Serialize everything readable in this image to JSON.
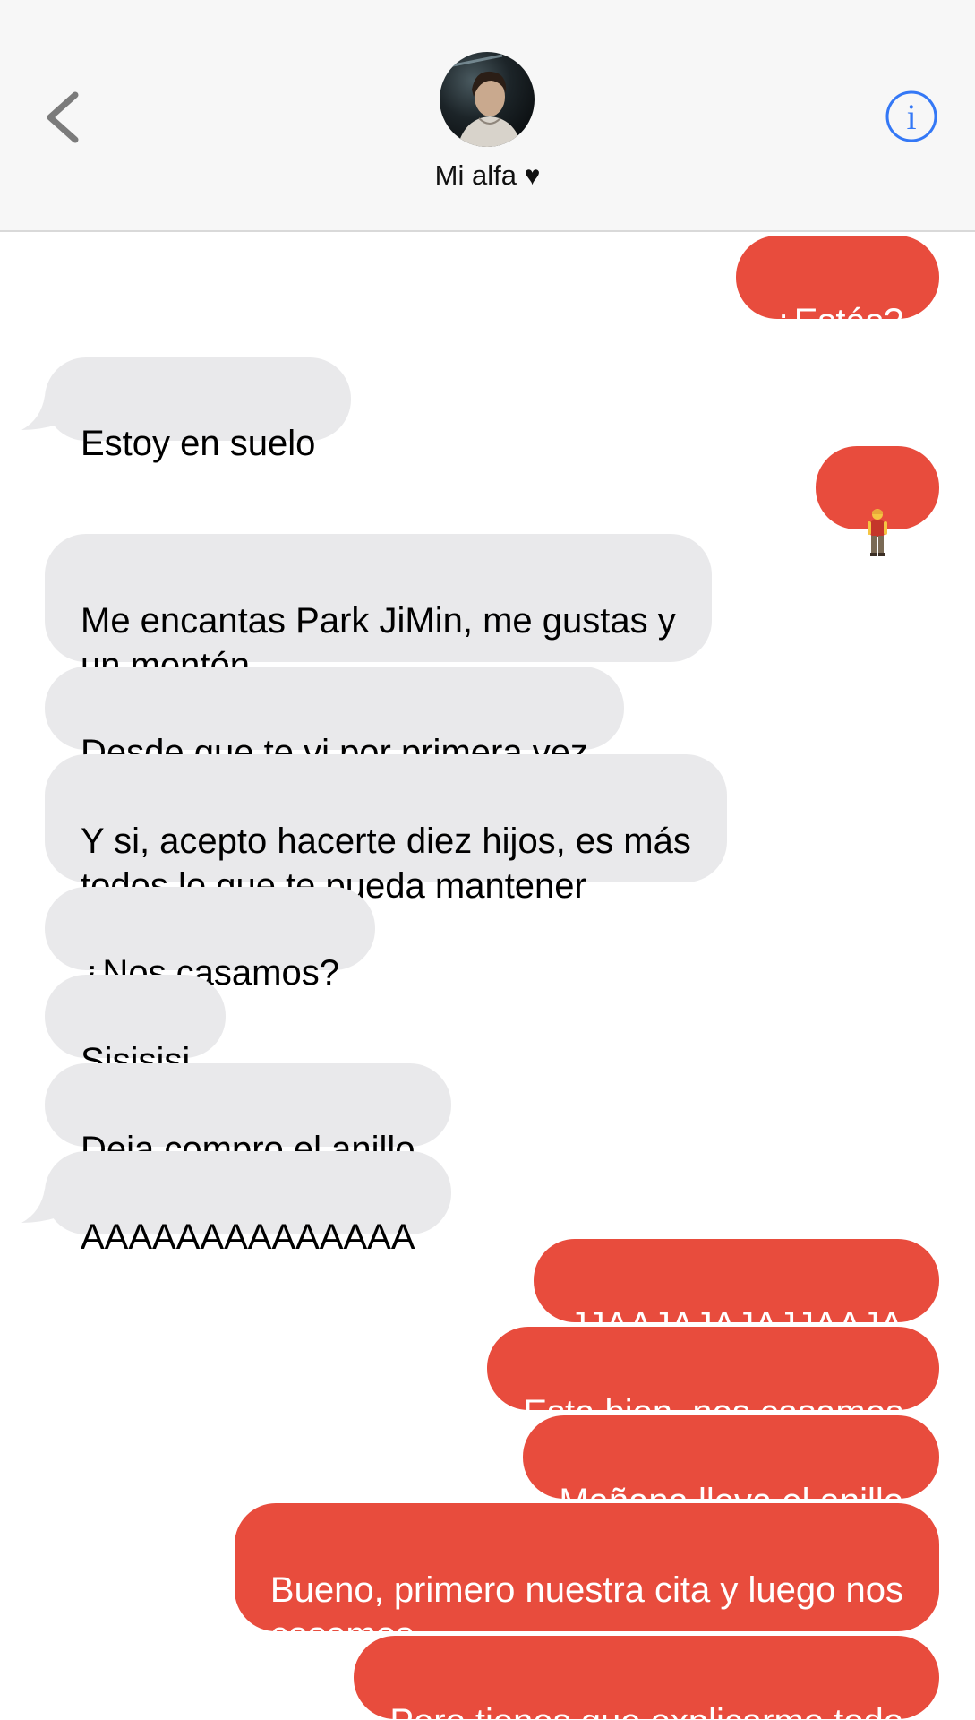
{
  "header": {
    "contact_name": "Mi alfa",
    "heart_glyph": "♥",
    "back_icon": "chevron-left-icon",
    "info_icon": "info-circle-icon",
    "info_glyph": "i"
  },
  "colors": {
    "sent_bubble": "#e84c3d",
    "received_bubble": "#e9e9eb",
    "accent": "#3478f6"
  },
  "messages": [
    {
      "direction": "out",
      "text": "¿Estás?"
    },
    {
      "direction": "in",
      "text": "Estoy en suelo"
    },
    {
      "direction": "out",
      "text": "",
      "emoji": "person-standing-emoji"
    },
    {
      "direction": "in",
      "text": "Me encantas Park JiMin, me gustas y\nun montón"
    },
    {
      "direction": "in",
      "text": "Desde que te vi por primera vez"
    },
    {
      "direction": "in",
      "text": "Y si, acepto hacerte diez hijos, es más\ntodos lo que te pueda mantener"
    },
    {
      "direction": "in",
      "text": "¿Nos casamos?"
    },
    {
      "direction": "in",
      "text": "Sisisisi"
    },
    {
      "direction": "in",
      "text": "Deja compro el anillo"
    },
    {
      "direction": "in",
      "text": "AAAAAAAAAAAAAA"
    },
    {
      "direction": "out",
      "text": "JJAAJAJAJAJJAAJA"
    },
    {
      "direction": "out",
      "text": "Esta bien, nos casamos"
    },
    {
      "direction": "out",
      "text": "Mañana lleva el anillo"
    },
    {
      "direction": "out",
      "text": "Bueno, primero nuestra cita y luego nos\ncasamos"
    },
    {
      "direction": "out",
      "text": "Pero tienes que explicarme todo"
    }
  ]
}
